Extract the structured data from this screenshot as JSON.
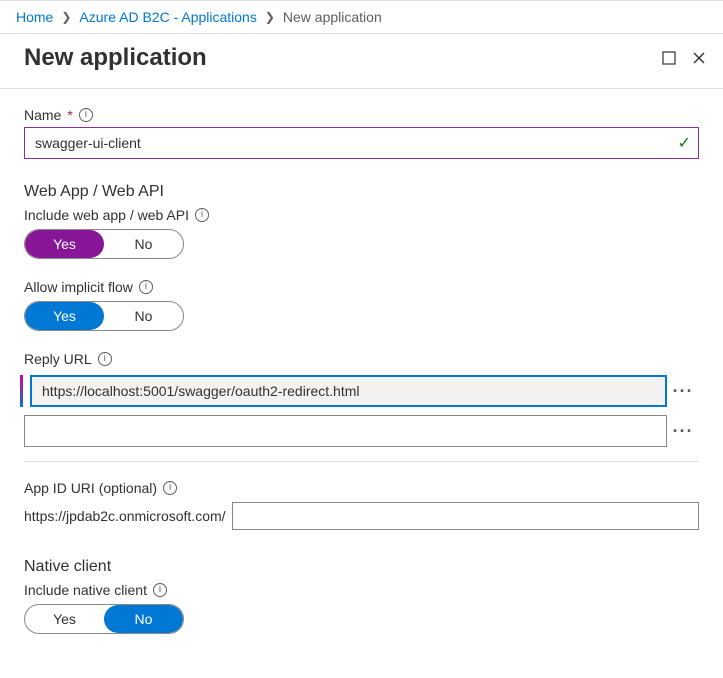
{
  "breadcrumb": {
    "home": "Home",
    "level2": "Azure AD B2C - Applications",
    "current": "New application"
  },
  "header": {
    "title": "New application"
  },
  "name": {
    "label": "Name",
    "value": "swagger-ui-client"
  },
  "webapp": {
    "section_title": "Web App / Web API",
    "include_label": "Include web app / web API",
    "include_yes": "Yes",
    "include_no": "No",
    "implicit_label": "Allow implicit flow",
    "implicit_yes": "Yes",
    "implicit_no": "No",
    "reply_label": "Reply URL",
    "reply_urls": [
      "https://localhost:5001/swagger/oauth2-redirect.html",
      ""
    ],
    "appid_label": "App ID URI (optional)",
    "appid_prefix": "https://jpdab2c.onmicrosoft.com/",
    "appid_value": ""
  },
  "native": {
    "section_title": "Native client",
    "include_label": "Include native client",
    "include_yes": "Yes",
    "include_no": "No"
  }
}
